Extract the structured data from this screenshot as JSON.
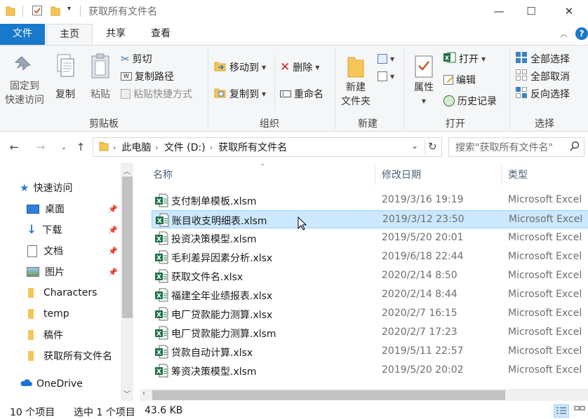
{
  "window": {
    "title": "获取所有文件名",
    "minimize": "—",
    "maximize": "☐",
    "close": "✕"
  },
  "ribbon_tabs": [
    "文件",
    "主页",
    "共享",
    "查看"
  ],
  "ribbon": {
    "clipboard": {
      "label": "剪贴板",
      "pin_line1": "固定到",
      "pin_line2": "快速访问",
      "copy": "复制",
      "paste": "粘贴",
      "cut": "剪切",
      "copy_path": "复制路径",
      "paste_shortcut": "粘贴快捷方式"
    },
    "organize": {
      "label": "组织",
      "move_to": "移动到",
      "copy_to": "复制到",
      "delete": "删除",
      "rename": "重命名"
    },
    "new": {
      "label": "新建",
      "new_folder_line1": "新建",
      "new_folder_line2": "文件夹"
    },
    "open": {
      "label": "打开",
      "properties": "属性",
      "open": "打开",
      "edit": "编辑",
      "history": "历史记录"
    },
    "select": {
      "label": "选择",
      "select_all": "全部选择",
      "select_none": "全部取消",
      "invert": "反向选择"
    }
  },
  "address": {
    "crumbs": [
      "此电脑",
      "文件 (D:)",
      "获取所有文件名"
    ],
    "search_placeholder": "搜索\"获取所有文件名\""
  },
  "nav_pane": {
    "quick_access": "快速访问",
    "items": [
      "桌面",
      "下载",
      "文档",
      "图片",
      "Characters",
      "temp",
      "稿件",
      "获取所有文件名"
    ],
    "onedrive": "OneDrive"
  },
  "columns": {
    "name": "名称",
    "date": "修改日期",
    "type": "类型"
  },
  "files": [
    {
      "name": "支付制单模板.xlsm",
      "date": "2019/3/16 19:19",
      "type": "Microsoft Excel"
    },
    {
      "name": "账目收支明细表.xlsm",
      "date": "2019/3/12 23:50",
      "type": "Microsoft Excel"
    },
    {
      "name": "投资决策模型.xlsm",
      "date": "2019/5/20 20:01",
      "type": "Microsoft Excel"
    },
    {
      "name": "毛利差异因素分析.xlsx",
      "date": "2019/6/18 22:44",
      "type": "Microsoft Excel"
    },
    {
      "name": "获取文件名.xlsx",
      "date": "2020/2/14 8:50",
      "type": "Microsoft Excel"
    },
    {
      "name": "福建全年业绩报表.xlsx",
      "date": "2020/2/14 8:44",
      "type": "Microsoft Excel"
    },
    {
      "name": "电厂贷款能力测算.xlsx",
      "date": "2020/2/7 16:15",
      "type": "Microsoft Excel"
    },
    {
      "name": "电厂贷款能力测算.xlsm",
      "date": "2020/2/7 17:23",
      "type": "Microsoft Excel"
    },
    {
      "name": "贷款自动计算.xlsx",
      "date": "2019/5/11 22:57",
      "type": "Microsoft Excel"
    },
    {
      "name": "筹资决策模型.xlsm",
      "date": "2019/5/20 20:02",
      "type": "Microsoft Excel"
    }
  ],
  "selected_index": 1,
  "status": {
    "count": "10 个项目",
    "selection": "选中 1 个项目",
    "size": "43.6 KB"
  }
}
